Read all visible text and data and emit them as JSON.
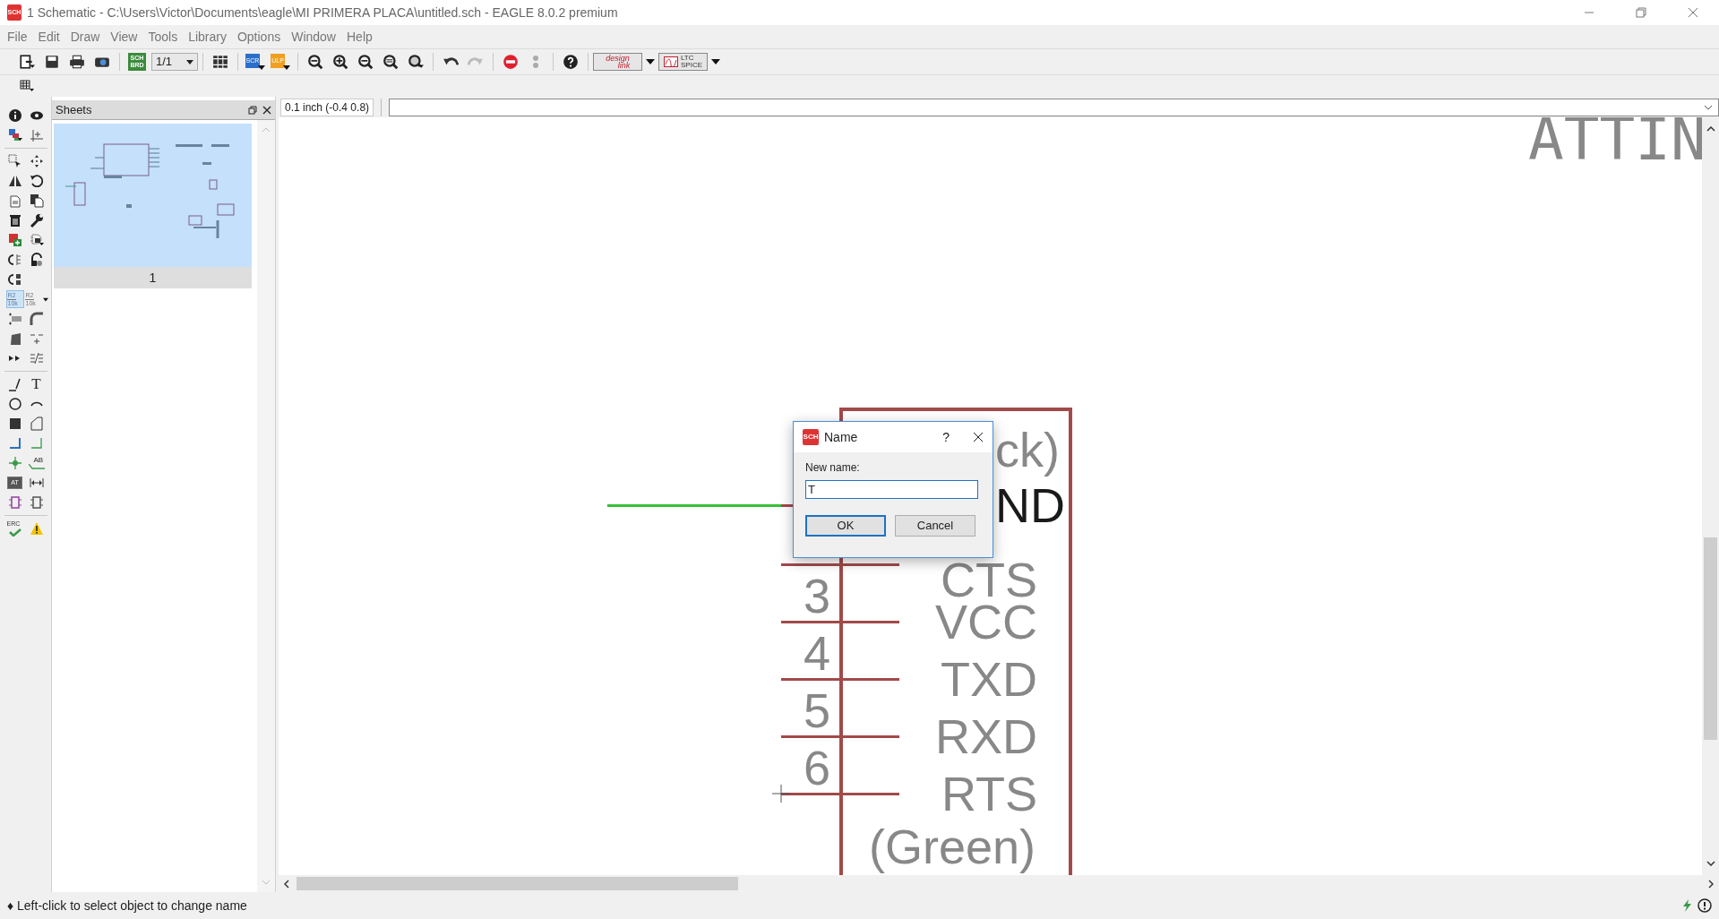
{
  "window": {
    "title": "1 Schematic - C:\\Users\\Victor\\Documents\\eagle\\MI PRIMERA PLACA\\untitled.sch - EAGLE 8.0.2 premium",
    "icon_label": "SCH"
  },
  "menu": [
    "File",
    "Edit",
    "Draw",
    "View",
    "Tools",
    "Library",
    "Options",
    "Window",
    "Help"
  ],
  "toolbar": {
    "board_switch": [
      "SCH",
      "BRD"
    ],
    "sheet_select": "1/1",
    "script": "SCR",
    "ulp": "ULP",
    "design_link": [
      "design",
      "link"
    ],
    "ltspice": [
      "LTC",
      "SPICE"
    ]
  },
  "tools": {
    "value_buttons": [
      {
        "lines": [
          "R2",
          "10k"
        ],
        "selected": true,
        "menu": false
      },
      {
        "lines": [
          "R2",
          "10k"
        ],
        "selected": false,
        "menu": true
      }
    ],
    "text_tool": "T",
    "label_tool": "AB",
    "attribute_tool": "AT",
    "erc": "ERC"
  },
  "sheets": {
    "title": "Sheets",
    "items": [
      {
        "label": "1",
        "selected": true
      }
    ]
  },
  "coordinates": "0.1 inch (-0.4 0.8)",
  "schematic": {
    "part_name": "ATTIN",
    "top_label": "ck)",
    "bottom_label": "(Green)",
    "pins": [
      {
        "kind": "fragment",
        "name": "ND",
        "highlighted": true
      },
      {
        "kind": "pin",
        "name": "CTS",
        "highlighted": false
      },
      {
        "kind": "pin",
        "number": "3",
        "name": "VCC",
        "highlighted": false
      },
      {
        "kind": "pin",
        "number": "4",
        "name": "TXD",
        "highlighted": false
      },
      {
        "kind": "pin",
        "number": "5",
        "name": "RXD",
        "highlighted": false
      },
      {
        "kind": "pin",
        "number": "6",
        "name": "RTS",
        "highlighted": false
      }
    ]
  },
  "dialog": {
    "title": "Name",
    "icon_label": "SCH",
    "help": "?",
    "label": "New name:",
    "value": "T",
    "buttons": [
      {
        "label": "OK",
        "default": true
      },
      {
        "label": "Cancel",
        "default": false
      }
    ]
  },
  "status": "♦ Left-click to select object to change name"
}
